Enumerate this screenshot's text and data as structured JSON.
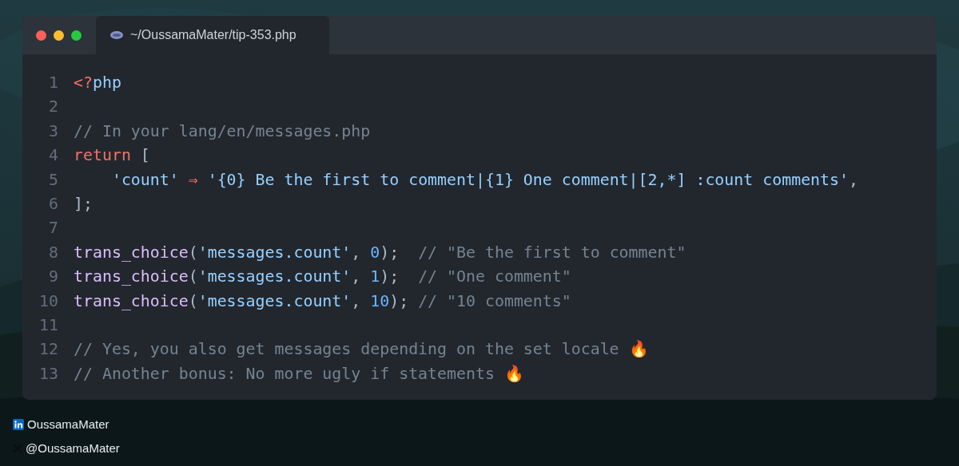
{
  "window": {
    "tab_title": "~/OussamaMater/tip-353.php"
  },
  "code": [
    {
      "number": "1",
      "tokens": [
        {
          "kind": "keyword",
          "text": "<?"
        },
        {
          "kind": "string",
          "text": "php"
        }
      ]
    },
    {
      "number": "2"
    },
    {
      "number": "3",
      "tokens": [
        {
          "kind": "comment",
          "text": "// In your lang/en/messages.php"
        }
      ]
    },
    {
      "number": "4",
      "tokens": [
        {
          "kind": "keyword",
          "text": "return"
        },
        {
          "kind": "plain",
          "text": " ["
        }
      ]
    },
    {
      "number": "5",
      "tokens": [
        {
          "kind": "string",
          "text": "    'count'"
        },
        {
          "kind": "keyword",
          "text": " ⇒ "
        },
        {
          "kind": "string",
          "text": "'{0} Be the first to comment|{1} One comment|[2,*] :count comments'"
        },
        {
          "kind": "plain",
          "text": ","
        }
      ]
    },
    {
      "number": "6",
      "tokens": [
        {
          "kind": "plain",
          "text": "];"
        }
      ]
    },
    {
      "number": "7"
    },
    {
      "number": "8",
      "tokens": [
        {
          "kind": "function",
          "text": "trans_choice"
        },
        {
          "kind": "plain",
          "text": "("
        },
        {
          "kind": "string",
          "text": "'messages.count'"
        },
        {
          "kind": "plain",
          "text": ", "
        },
        {
          "kind": "number",
          "text": "0"
        },
        {
          "kind": "plain",
          "text": ");  "
        },
        {
          "kind": "comment",
          "text": "// \"Be the first to comment\""
        }
      ]
    },
    {
      "number": "9",
      "tokens": [
        {
          "kind": "function",
          "text": "trans_choice"
        },
        {
          "kind": "plain",
          "text": "("
        },
        {
          "kind": "string",
          "text": "'messages.count'"
        },
        {
          "kind": "plain",
          "text": ", "
        },
        {
          "kind": "number",
          "text": "1"
        },
        {
          "kind": "plain",
          "text": ");  "
        },
        {
          "kind": "comment",
          "text": "// \"One comment\""
        }
      ]
    },
    {
      "number": "10",
      "tokens": [
        {
          "kind": "function",
          "text": "trans_choice"
        },
        {
          "kind": "plain",
          "text": "("
        },
        {
          "kind": "string",
          "text": "'messages.count'"
        },
        {
          "kind": "plain",
          "text": ", "
        },
        {
          "kind": "number",
          "text": "10"
        },
        {
          "kind": "plain",
          "text": "); "
        },
        {
          "kind": "comment",
          "text": "// \"10 comments\""
        }
      ]
    },
    {
      "number": "11"
    },
    {
      "number": "12",
      "tokens": [
        {
          "kind": "comment",
          "text": "// Yes, you also get messages depending on the set locale 🔥"
        }
      ]
    },
    {
      "number": "13",
      "tokens": [
        {
          "kind": "comment",
          "text": "// Another bonus: No more ugly if statements 🔥"
        }
      ]
    }
  ],
  "footer": [
    {
      "kind": "linkedin",
      "text": "OussamaMater"
    },
    {
      "kind": "x",
      "text": "@OussamaMater"
    }
  ]
}
